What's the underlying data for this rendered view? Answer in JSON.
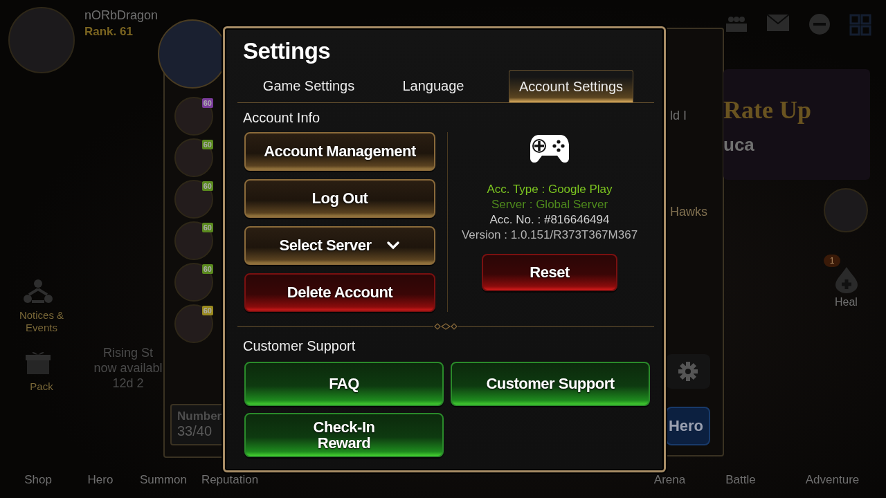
{
  "background": {
    "player": {
      "name": "nORbDragon",
      "rank": "Rank. 61"
    },
    "side_menu": [
      {
        "label": "Notices & Events"
      },
      {
        "label": "Pack"
      }
    ],
    "event_banner": [
      "Rising St",
      "now availabl",
      "12d 2"
    ],
    "heroes": [
      {
        "level": "60",
        "color": "#7a3c9a"
      },
      {
        "level": "60",
        "color": "#5a8a1e"
      },
      {
        "level": "60",
        "color": "#5a8a1e"
      },
      {
        "level": "60",
        "color": "#5a8a1e"
      },
      {
        "level": "60",
        "color": "#5a8a1e"
      },
      {
        "level": "60",
        "color": "#9a8a1e"
      }
    ],
    "hero_count": {
      "label": "Number",
      "value": "33/40"
    },
    "guild": {
      "rank": "ld I",
      "name": "Hawks"
    },
    "banner": {
      "title": "Rate Up",
      "name": "uca"
    },
    "heal": {
      "label": "Heal",
      "badge": "1"
    },
    "hero_button": "Hero",
    "bottom_nav_left": [
      "Shop",
      "Hero",
      "Summon",
      "Reputation"
    ],
    "bottom_nav_right": [
      "Arena",
      "Battle",
      "Adventure"
    ]
  },
  "dialog": {
    "title": "Settings",
    "tabs": [
      {
        "label": "Game Settings",
        "selected": false
      },
      {
        "label": "Language",
        "selected": false
      },
      {
        "label": "Account Settings",
        "selected": true
      }
    ],
    "account_info": {
      "heading": "Account Info",
      "buttons": [
        {
          "label": "Account Management",
          "kind": "gold",
          "dropdown": false
        },
        {
          "label": "Log Out",
          "kind": "gold",
          "dropdown": false
        },
        {
          "label": "Select Server",
          "kind": "gold",
          "dropdown": true
        },
        {
          "label": "Delete Account",
          "kind": "red",
          "dropdown": false
        }
      ],
      "details": [
        {
          "text": "Acc. Type : Google Play",
          "color": "#7cc520"
        },
        {
          "text": "Server : Global Server",
          "color": "#4e8a1c"
        },
        {
          "text": "Acc. No. : #816646494",
          "color": "#d0d0d0"
        },
        {
          "text": "Version : 1.0.151/R373T367M367",
          "color": "#b4b4b4"
        }
      ],
      "reset_button": {
        "label": "Reset",
        "kind": "red",
        "dropdown": false
      }
    },
    "customer_support": {
      "heading": "Customer Support",
      "buttons": [
        {
          "label": "FAQ",
          "kind": "green",
          "dropdown": false
        },
        {
          "label": "Customer Support",
          "kind": "green",
          "dropdown": false
        },
        {
          "label": "Check-In Reward",
          "kind": "green",
          "dropdown": false
        }
      ]
    }
  }
}
